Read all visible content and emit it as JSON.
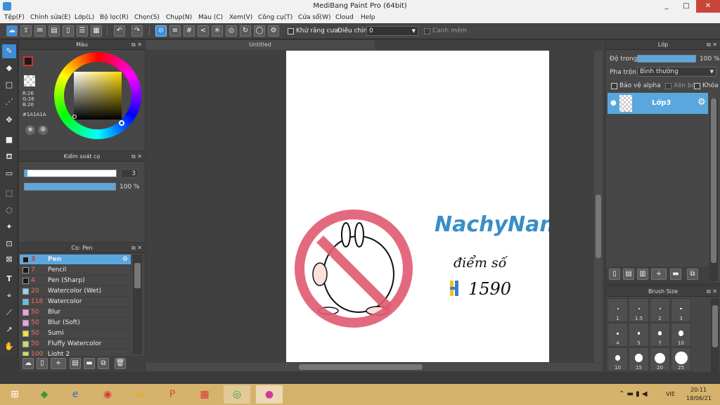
{
  "window": {
    "title": "MediBang Paint Pro (64bit)",
    "minimize": "_",
    "maximize": "□",
    "close": "✕"
  },
  "menu": [
    "Tệp(F)",
    "Chỉnh sửa(E)",
    "Lớp(L)",
    "Bộ lọc(R)",
    "Chọn(S)",
    "Chụp(N)",
    "Màu (C)",
    "Xem(V)",
    "Công cụ(T)",
    "Cửa sổ(W)",
    "Cloud",
    "Help"
  ],
  "toolbar": {
    "antialias_label": "Khử răng cưa",
    "adjust_label": "Điều chỉnh",
    "adjust_value": "0",
    "edge_label": "Canh mềm"
  },
  "color_panel": {
    "title": "Màu",
    "r": "R:26",
    "g": "G:26",
    "b": "B:26",
    "hex": "#1A1A1A"
  },
  "brush_control": {
    "title": "Kiểm soát cọ",
    "size": "3",
    "opacity": "100 %",
    "opacity_fraction": 1.0,
    "size_fraction": 0.03
  },
  "brush_panel": {
    "title": "Cọ: Pen",
    "items": [
      {
        "size": "3",
        "name": "Pen",
        "color": "#1a1a1a",
        "selected": true
      },
      {
        "size": "7",
        "name": "Pencil",
        "color": "#1a1a1a"
      },
      {
        "size": "4",
        "name": "Pen (Sharp)",
        "color": "#1a1a1a"
      },
      {
        "size": "20",
        "name": "Watercolor (Wet)",
        "color": "#8fd3f0"
      },
      {
        "size": "118",
        "name": "Watercolor",
        "color": "#5ec0e8"
      },
      {
        "size": "50",
        "name": "Blur",
        "color": "#f0a0e0"
      },
      {
        "size": "50",
        "name": "Blur (Soft)",
        "color": "#f0a0e0"
      },
      {
        "size": "50",
        "name": "Sumi",
        "color": "#f0e040"
      },
      {
        "size": "50",
        "name": "Fluffy Watercolor",
        "color": "#c0e060"
      },
      {
        "size": "100",
        "name": "Light 2",
        "color": "#c0e060"
      }
    ]
  },
  "canvas": {
    "tab": "Untitled",
    "signature": "NachyNan",
    "score_label": "điểm số",
    "score_value": "1590"
  },
  "layer_panel": {
    "title": "Lớp",
    "opacity_label": "Độ trong",
    "opacity_value": "100 %",
    "blend_label": "Pha trộn",
    "blend_value": "Bình thường",
    "protect_alpha": "Bảo vệ alpha",
    "clipping": "Xén bớt",
    "lock": "Khóa",
    "layers": [
      {
        "name": "Lớp3"
      }
    ]
  },
  "brush_size_panel": {
    "title": "Brush Size",
    "sizes": [
      "1",
      "1.5",
      "2",
      "3",
      "4",
      "5",
      "7",
      "10",
      "10",
      "15",
      "20",
      "25"
    ]
  },
  "taskbar": {
    "lang": "VIE",
    "time": "20:11",
    "date": "18/06/21"
  },
  "colors": {
    "accent": "#5aa7e0",
    "highlight_text": "#f0c040"
  }
}
